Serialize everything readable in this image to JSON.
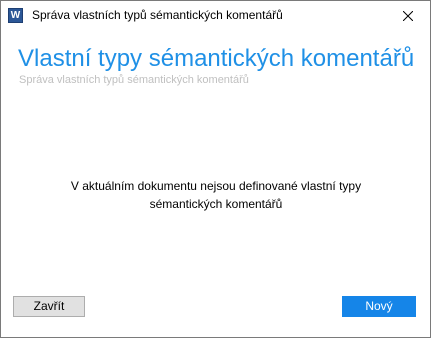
{
  "window": {
    "title": "Správa vlastních typů sémantických komentářů",
    "app_icon_letter": "W",
    "app_icon_name": "word-icon",
    "close_icon_name": "close-icon"
  },
  "header": {
    "title": "Vlastní typy sémantických komentářů",
    "subtitle": "Správa vlastních typů sémantických komentářů"
  },
  "content": {
    "empty_message": "V aktuálním dokumentu nejsou definované vlastní typy sémantických komentářů"
  },
  "footer": {
    "close_label": "Zavřít",
    "new_label": "Nový"
  },
  "colors": {
    "accent": "#1f90e6",
    "primary_button": "#1585e8",
    "secondary_button": "#e1e1e1",
    "subtitle_text": "#c0c0c0"
  }
}
